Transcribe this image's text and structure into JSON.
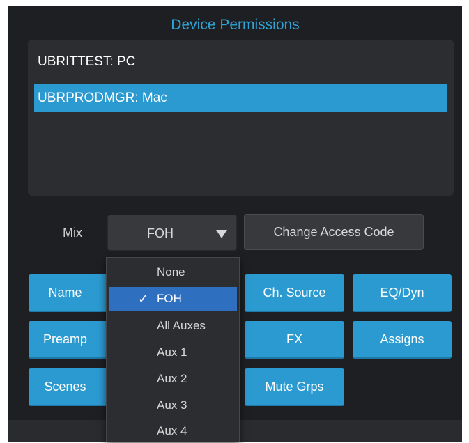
{
  "title": "Device Permissions",
  "devices": [
    {
      "label": "UBRITTEST: PC",
      "selected": false
    },
    {
      "label": "UBRPRODMGR: Mac",
      "selected": true
    }
  ],
  "mix": {
    "label": "Mix",
    "value": "FOH",
    "options": [
      "None",
      "FOH",
      "All Auxes",
      "Aux 1",
      "Aux 2",
      "Aux 3",
      "Aux 4"
    ],
    "check_glyph": "✓"
  },
  "change_access_code_label": "Change Access Code",
  "permission_buttons": {
    "name": "Name",
    "preamp": "Preamp",
    "scenes": "Scenes",
    "ch_source": "Ch. Source",
    "eq_dyn": "EQ/Dyn",
    "fx": "FX",
    "assigns": "Assigns",
    "mute_grps": "Mute Grps"
  },
  "colors": {
    "accent": "#2b9ad0",
    "title": "#2fa3d6",
    "dropdown_highlight": "#2e6fc0",
    "background": "#1e1f22"
  },
  "icons": {
    "dropdown_arrow": "triangle-down-icon",
    "selected_check": "checkmark-icon"
  }
}
